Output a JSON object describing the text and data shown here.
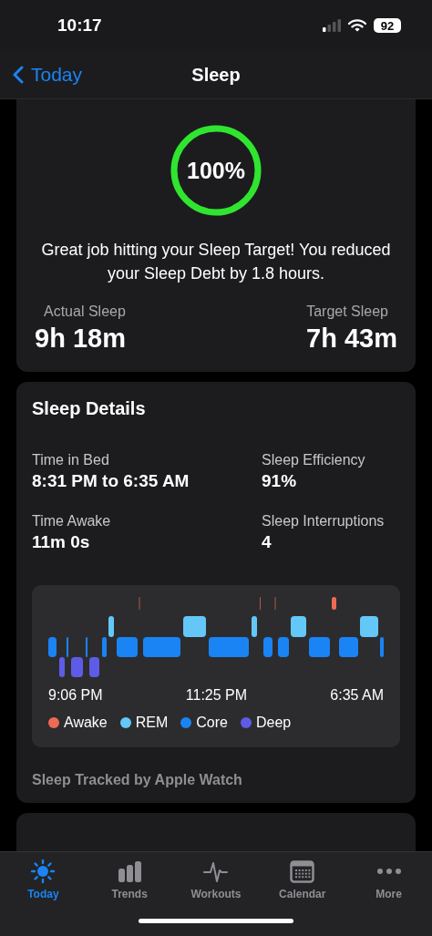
{
  "status_bar": {
    "time": "10:17",
    "battery": "92"
  },
  "nav": {
    "back": "Today",
    "title": "Sleep"
  },
  "summary": {
    "ring": {
      "label": "100%",
      "level": 1
    },
    "message": "Great job hitting your Sleep Target! You reduced your Sleep Debt by 1.8 hours.",
    "stats": [
      {
        "label": "Actual Sleep",
        "value": "9h 18m"
      },
      {
        "label": "Target Sleep",
        "value": "7h 43m"
      }
    ]
  },
  "details": {
    "title": "Sleep Details",
    "metrics": [
      {
        "label": "Time in Bed",
        "value": "8:31 PM to 6:35 AM"
      },
      {
        "label": "Sleep Efficiency",
        "value": "91%"
      },
      {
        "label": "Time Awake",
        "value": "11m 0s"
      },
      {
        "label": "Sleep Interruptions",
        "value": "4"
      }
    ],
    "times": [
      "9:06 PM",
      "11:25 PM",
      "6:35 AM"
    ],
    "legend": [
      {
        "label": "Awake",
        "color": "#ef6a55"
      },
      {
        "label": "REM",
        "color": "#63c8f7"
      },
      {
        "label": "Core",
        "color": "#1a84f5"
      },
      {
        "label": "Deep",
        "color": "#5e5ce6"
      }
    ],
    "footer": "Sleep Tracked by Apple Watch"
  },
  "tabs": [
    {
      "label": "Today",
      "selected": true
    },
    {
      "label": "Trends",
      "selected": false
    },
    {
      "label": "Workouts",
      "selected": false
    },
    {
      "label": "Calendar",
      "selected": false
    },
    {
      "label": "More",
      "selected": false
    }
  ]
}
